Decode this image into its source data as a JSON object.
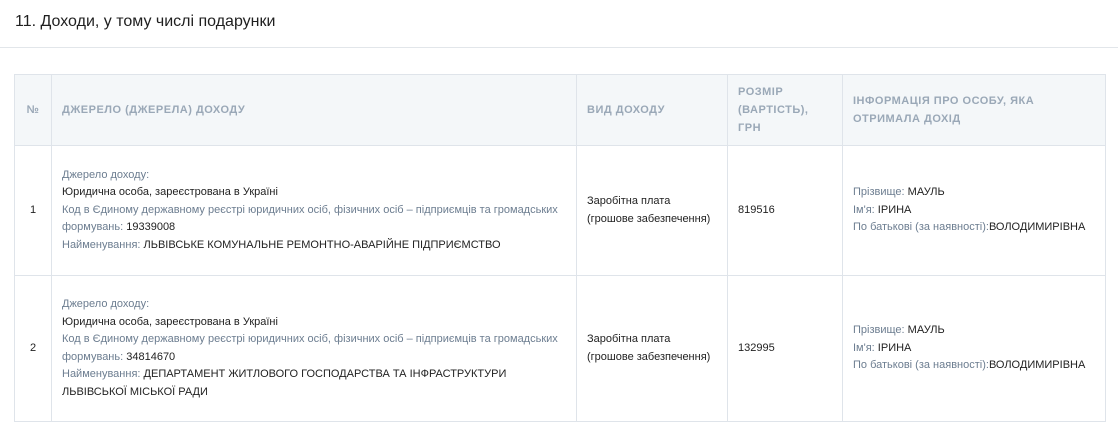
{
  "section": {
    "title": "11. Доходи, у тому числі подарунки"
  },
  "table": {
    "headers": {
      "num": "№",
      "source": "ДЖЕРЕЛО (ДЖЕРЕЛА) ДОХОДУ",
      "type": "ВИД ДОХОДУ",
      "amount": "РОЗМІР (ВАРТІСТЬ), ГРН",
      "person": "ІНФОРМАЦІЯ ПРО ОСОБУ, ЯКА ОТРИМАЛА ДОХІД"
    },
    "labels": {
      "source": "Джерело доходу:",
      "code": "Код в Єдиному державному реєстрі юридичних осіб, фізичних осіб – підприємців та громадських формувань:",
      "name": "Найменування:",
      "surname": "Прізвище:",
      "firstname": "Ім'я:",
      "patronymic": "По батькові (за наявності):"
    },
    "rows": [
      {
        "num": "1",
        "source_type": "Юридична особа, зареєстрована в Україні",
        "code": "19339008",
        "name": "ЛЬВІВСЬКЕ КОМУНАЛЬНЕ РЕМОНТНО-АВАРІЙНЕ ПІДПРИЄМСТВО",
        "income_type": "Заробітна плата (грошове забезпечення)",
        "amount": "819516",
        "surname": "МАУЛЬ",
        "firstname": "ІРИНА",
        "patronymic": "ВОЛОДИМИРІВНА"
      },
      {
        "num": "2",
        "source_type": "Юридична особа, зареєстрована в Україні",
        "code": "34814670",
        "name": "ДЕПАРТАМЕНТ ЖИТЛОВОГО ГОСПОДАРСТВА ТА ІНФРАСТРУКТУРИ ЛЬВІВСЬКОЇ МІСЬКОЇ РАДИ",
        "income_type": "Заробітна плата (грошове забезпечення)",
        "amount": "132995",
        "surname": "МАУЛЬ",
        "firstname": "ІРИНА",
        "patronymic": "ВОЛОДИМИРІВНА"
      }
    ]
  }
}
